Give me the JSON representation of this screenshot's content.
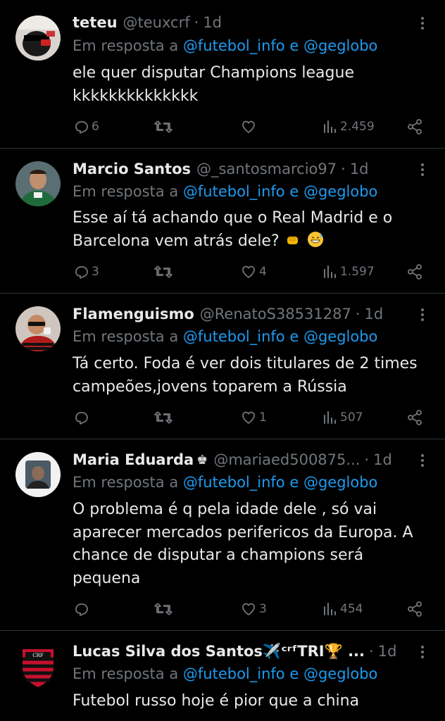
{
  "tweets": [
    {
      "name": "teteu",
      "badge": "",
      "handle": "@teuxcrf",
      "dot": "·",
      "time": "1d",
      "reply_prefix": "Em resposta a",
      "mention1": "@futebol_info",
      "reply_and": "e",
      "mention2": "@geglobo",
      "text": "ele quer disputar Champions league kkkkkkkkkkkkkk",
      "replies": "6",
      "retweets": "",
      "likes": "",
      "views": "2.459"
    },
    {
      "name": "Marcio Santos",
      "badge": "",
      "handle": "@_santosmarcio97",
      "dot": "·",
      "time": "1d",
      "reply_prefix": "Em resposta a",
      "mention1": "@futebol_info",
      "reply_and": "e",
      "mention2": "@geglobo",
      "text": "Esse aí tá achando que o Real Madrid e o Barcelona vem atrás dele?",
      "replies": "3",
      "retweets": "",
      "likes": "4",
      "views": "1.597"
    },
    {
      "name": "Flamenguismo",
      "badge": "",
      "handle": "@RenatoS38531287",
      "dot": "·",
      "time": "1d",
      "reply_prefix": "Em resposta a",
      "mention1": "@futebol_info",
      "reply_and": "e",
      "mention2": "@geglobo",
      "text": "Tá certo. Foda é ver dois titulares de 2 times campeões,jovens toparem a Rússia",
      "replies": "",
      "retweets": "",
      "likes": "1",
      "views": "507"
    },
    {
      "name": "Maria Eduarda",
      "badge": "♚",
      "handle": "@mariaed500875...",
      "dot": "·",
      "time": "1d",
      "reply_prefix": "Em resposta a",
      "mention1": "@futebol_info",
      "reply_and": "e",
      "mention2": "@geglobo",
      "text": "O problema é q pela idade dele , só vai aparecer mercados perifericos da Europa. A chance de disputar a champions será pequena",
      "replies": "",
      "retweets": "",
      "likes": "3",
      "views": "454"
    },
    {
      "name": "Lucas Silva dos Santos✈️ᶜʳᶠTRI🏆 ...",
      "badge": "",
      "handle": "",
      "dot": "·",
      "time": "1d",
      "reply_prefix": "Em resposta a",
      "mention1": "@futebol_info",
      "reply_and": "e",
      "mention2": "@geglobo",
      "text": "Futebol russo hoje é pior que a china",
      "replies": "",
      "retweets": "",
      "likes": "",
      "views": ""
    }
  ],
  "icons": {
    "reply": "reply-icon",
    "retweet": "retweet-icon",
    "like": "heart-icon",
    "views": "views-icon",
    "share": "share-icon",
    "more": "more-icon"
  },
  "colors": {
    "background": "#000000",
    "text": "#e7e9ea",
    "muted": "#71767b",
    "mention": "#1d9bf0",
    "divider": "#2f3336"
  }
}
